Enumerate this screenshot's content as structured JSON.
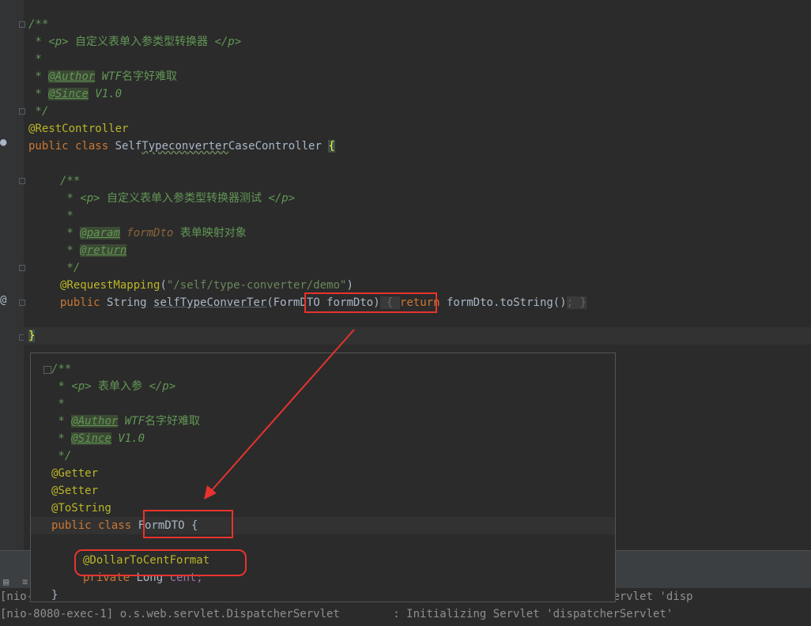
{
  "editor": {
    "l1": "/**",
    "l2a": " * <p> ",
    "l2b": "自定义表单入参类型转换器",
    "l2c": " </p>",
    "l3": " *",
    "l4a": " * ",
    "l4tag": "@Author",
    "l4b": " WTF",
    "l4c": "名字好难取",
    "l5a": " * ",
    "l5tag": "@Since",
    "l5b": " V1.0",
    "l6": " */",
    "l7": "@RestController",
    "l8kw": "public class ",
    "l8a": "Self",
    "l8b": "Typeconverter",
    "l8c": "CaseController ",
    "l8brace": "{",
    "l10": "/**",
    "l11a": " * <p> ",
    "l11b": "自定义表单入参类型转换器测试",
    "l11c": " </p>",
    "l12": " *",
    "l13a": " * ",
    "l13tag": "@param",
    "l13b": " formDto ",
    "l13c": "表单映射对象",
    "l14a": " * ",
    "l14tag": "@return",
    "l15": " */",
    "l16a": "@RequestMapping",
    "l16b": "(",
    "l16str": "\"/self/type-converter/demo\"",
    "l16c": ")",
    "l17kw": "public ",
    "l17a": "String ",
    "l17b": "selfTypeConverTer",
    "l17c": "(FormDTO formDto)",
    "l17d": " { ",
    "l17kw2": "return ",
    "l17e": "formDto.toString()",
    "l17f": "; }",
    "l19": "}"
  },
  "popup": {
    "p1": "/**",
    "p2a": " * <p> ",
    "p2b": "表单入参",
    "p2c": " </p>",
    "p3": " *",
    "p4a": " * ",
    "p4tag": "@Author",
    "p4b": " WTF",
    "p4c": "名字好难取",
    "p5a": " * ",
    "p5tag": "@Since",
    "p5b": " V1.0",
    "p6": " */",
    "p7": "@Getter",
    "p8": "@Setter",
    "p9": "@ToString",
    "p10kw": "public class ",
    "p10a": "FormDTO {",
    "p11": "@DollarToCentFormat",
    "p12kw": "private ",
    "p12a": "Long ",
    "p12b": "cent;",
    "p13": "}"
  },
  "console": {
    "line1": "[nio-8080-exec-1] o.s.web.servlet.DispatcherServlet        : Initializing Spring DispatcherServlet 'disp",
    "line2": "[nio-8080-exec-1] o.s.web.servlet.DispatcherServlet        : Initializing Servlet 'dispatcherServlet'"
  },
  "colors": {
    "comment": "#629755",
    "keyword": "#cc7832",
    "annotation": "#bbb529",
    "string": "#6a8759",
    "highlight": "#e8332e",
    "background": "#2b2b2b"
  }
}
